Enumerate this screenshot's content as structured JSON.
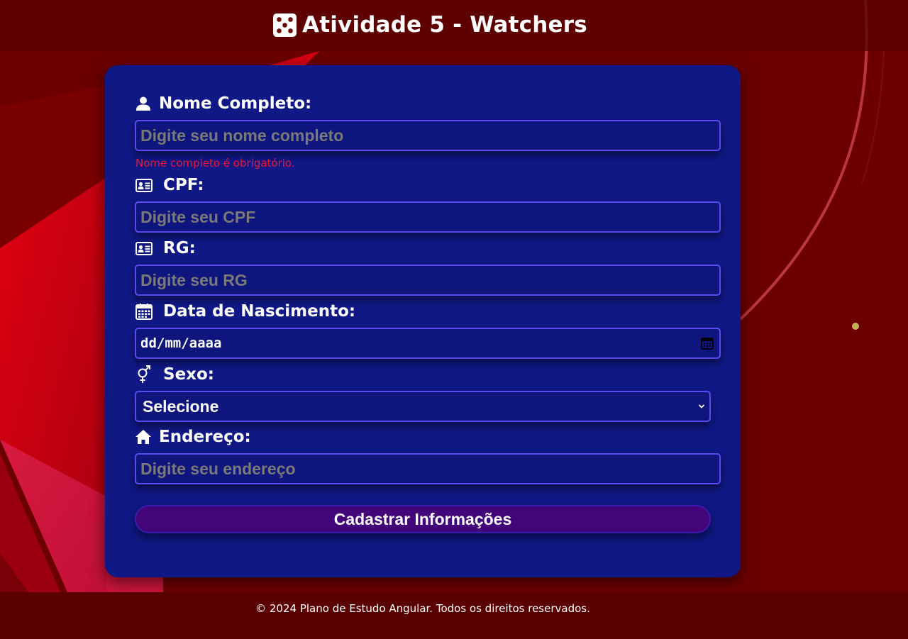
{
  "header": {
    "title": "Atividade 5 - Watchers"
  },
  "form": {
    "nome": {
      "label": "Nome Completo:",
      "placeholder": "Digite seu nome completo",
      "error": "Nome completo é obrigatório."
    },
    "cpf": {
      "label": "CPF:",
      "placeholder": "Digite seu CPF"
    },
    "rg": {
      "label": "RG:",
      "placeholder": "Digite seu RG"
    },
    "nascimento": {
      "label": "Data de Nascimento:",
      "value": "dd/mm/aaaa"
    },
    "sexo": {
      "label": "Sexo:",
      "value": "Selecione"
    },
    "endereco": {
      "label": "Endereço:",
      "placeholder": "Digite seu endereço"
    },
    "submit_label": "Cadastrar Informações"
  },
  "footer": {
    "text": "© 2024 Plano de Estudo Angular. Todos os direitos reservados."
  },
  "icons": {
    "title": "dice-icon",
    "nome": "user-icon",
    "cpf": "id-card-icon",
    "rg": "id-card-icon",
    "nascimento": "calendar-icon",
    "sexo": "gender-icon",
    "endereco": "home-icon",
    "date_picker": "calendar-picker-icon",
    "select": "chevron-down-icon"
  },
  "colors": {
    "background": "#6e0000",
    "card": "#0f1884",
    "field_border": "#5a4af0",
    "error": "#f2142f",
    "submit": "#43067a"
  }
}
